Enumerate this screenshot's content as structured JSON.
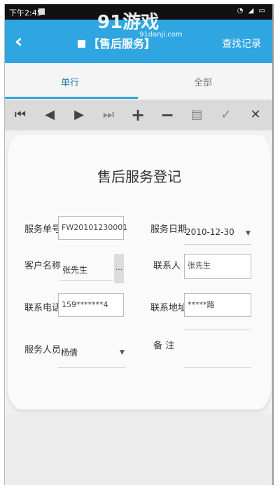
{
  "status_bar": {
    "time": "下午2:45"
  },
  "watermark": {
    "logo_text": "91游戏",
    "domain": "91danji.com"
  },
  "app_bar": {
    "title": "【售后服务】",
    "action": "查找记录"
  },
  "tabs": [
    {
      "label": "单行"
    },
    {
      "label": "全部"
    }
  ],
  "toolbar": {
    "buttons": [
      "first-icon",
      "prev-icon",
      "next-icon",
      "last-icon",
      "add-icon",
      "remove-icon",
      "save-icon",
      "confirm-icon",
      "cancel-icon"
    ]
  },
  "form": {
    "title": "售后服务登记",
    "service_no": {
      "label": "服务单号",
      "value": "FW20101230001"
    },
    "service_date": {
      "label": "服务日期",
      "value": "2010-12-30"
    },
    "customer_name": {
      "label": "客户名称",
      "value": "张先生"
    },
    "contact_person": {
      "label": "联系人",
      "value": "张先生"
    },
    "phone": {
      "label": "联系电话",
      "value": "159*******4"
    },
    "address": {
      "label": "联系地址",
      "value": "*****路"
    },
    "staff": {
      "label": "服务人员",
      "value": "杨倩"
    },
    "remark": {
      "label": "备 注",
      "value": ""
    }
  }
}
